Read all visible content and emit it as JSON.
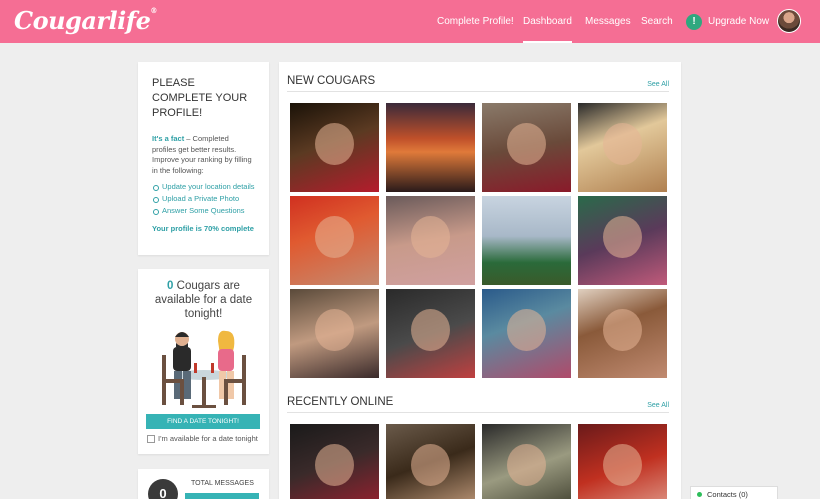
{
  "brand": {
    "logo_text": "Cougarlife",
    "accent": "#f56e94",
    "teal": "#2fa0a6"
  },
  "nav": {
    "complete_profile": "Complete Profile!",
    "dashboard": "Dashboard",
    "messages": "Messages",
    "search": "Search",
    "upgrade": "Upgrade Now",
    "upgrade_badge": "!"
  },
  "complete_profile_card": {
    "title": "Please complete your profile!",
    "fact_lead": "It's a fact",
    "fact_body": " – Completed profiles get better results. Improve your ranking by filling in the following:",
    "items": [
      "Update your location details",
      "Upload a Private Photo",
      "Answer Some Questions"
    ],
    "progress_text": "Your profile is 70% complete",
    "progress_value": 70
  },
  "date_card": {
    "count": "0",
    "headline": "Cougars are available for a date tonight!",
    "button": "Find a date tonight!",
    "checkbox_label": "I'm available for a date tonight",
    "checked": false
  },
  "messages_card": {
    "count": "0",
    "label": "Total Messages"
  },
  "new_cougars": {
    "title": "New Cougars",
    "see_all": "See All",
    "photos": [
      {
        "bg": "linear-gradient(160deg,#1a1208 0%,#5b3a22 45%,#b51c2c 100%)"
      },
      {
        "bg": "linear-gradient(180deg,#3a2a3a 0%,#c0502a 40%,#e07a3a 55%,#2a1a1a 100%)",
        "scene": true
      },
      {
        "bg": "linear-gradient(170deg,#8a7a6a 0%,#6a4a3a 50%,#8a1a2a 100%)"
      },
      {
        "bg": "linear-gradient(160deg,#2a2a2a 0%,#e2c89a 40%,#b08050 100%)"
      },
      {
        "bg": "linear-gradient(160deg,#d03020 0%,#e05a30 40%,#c58a70 100%)"
      },
      {
        "bg": "linear-gradient(170deg,#6a5a5a 0%,#c89a8a 50%,#d0a0a0 100%)"
      },
      {
        "bg": "linear-gradient(180deg,#c8d4e0 0%,#a8b8c8 45%,#2a6a3a 75%,#3a5a2a 100%)",
        "scene": true
      },
      {
        "bg": "linear-gradient(160deg,#2a6a4a 0%,#5a3a5a 50%,#c05a7a 100%)"
      },
      {
        "bg": "linear-gradient(165deg,#5a4a3a 0%,#c09a80 50%,#3a2a2a 100%)"
      },
      {
        "bg": "linear-gradient(160deg,#2a2a2a 0%,#4a4a4a 50%,#c04040 100%)"
      },
      {
        "bg": "linear-gradient(160deg,#2a5a8a 0%,#5a8aa0 40%,#b04a6a 100%)"
      },
      {
        "bg": "linear-gradient(160deg,#e0d0c0 0%,#8a5a3a 40%,#c08a70 100%)"
      }
    ]
  },
  "recently_online": {
    "title": "Recently Online",
    "see_all": "See All",
    "photos": [
      {
        "bg": "linear-gradient(160deg,#1a1a1a 0%,#3a2a2a 45%,#a02030 100%)"
      },
      {
        "bg": "linear-gradient(160deg,#6a5a4a 0%,#3a2a1a 45%,#c8a080 100%)"
      },
      {
        "bg": "linear-gradient(160deg,#2a2a2a 0%,#9a9a80 50%,#3a3a2a 100%)"
      },
      {
        "bg": "linear-gradient(160deg,#6a1a1a 0%,#c03020 50%,#e0a090 100%)"
      }
    ]
  },
  "contacts": {
    "label": "Contacts",
    "count": "(0)"
  }
}
